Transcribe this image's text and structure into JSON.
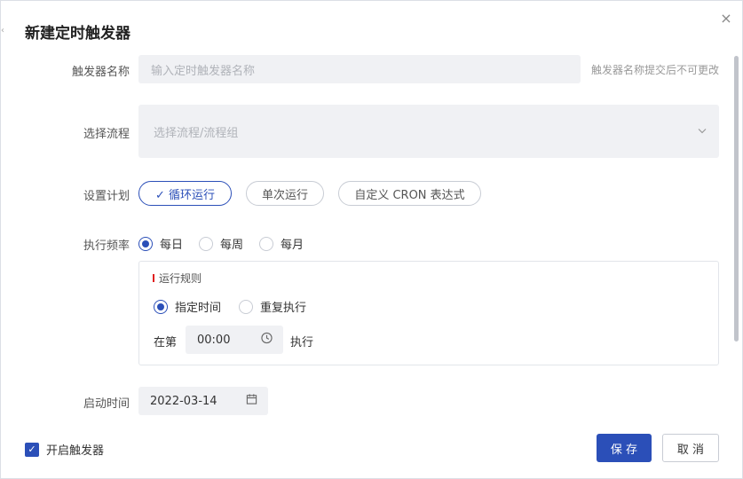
{
  "dialog": {
    "title": "新建定时触发器",
    "close_glyph": "×"
  },
  "form": {
    "trigger_name": {
      "label": "触发器名称",
      "placeholder": "输入定时触发器名称",
      "hint": "触发器名称提交后不可更改"
    },
    "flow": {
      "label": "选择流程",
      "placeholder": "选择流程/流程组"
    },
    "schedule": {
      "label": "设置计划",
      "options": [
        "✓ 循环运行",
        "单次运行",
        "自定义 CRON 表达式"
      ],
      "selected": "循环运行"
    },
    "frequency": {
      "label": "执行频率",
      "options": [
        "每日",
        "每周",
        "每月"
      ],
      "selected": "每日"
    },
    "rule": {
      "title": "运行规则",
      "options": [
        "指定时间",
        "重复执行"
      ],
      "selected": "指定时间",
      "prefix": "在第",
      "time": "00:00",
      "suffix": "执行"
    },
    "start_time": {
      "label": "启动时间",
      "value": "2022-03-14"
    }
  },
  "footer": {
    "enable_label": "开启触发器",
    "enable_checked": true,
    "save_label": "保 存",
    "cancel_label": "取 消"
  },
  "colors": {
    "accent": "#2b4fb8",
    "field_bg": "#f0f1f4",
    "required_marker": "#e02020"
  },
  "icons": {
    "close": "close-icon",
    "select_arrow": "chevron-down-icon",
    "clock": "clock-icon",
    "calendar": "calendar-icon",
    "check": "check-icon"
  }
}
